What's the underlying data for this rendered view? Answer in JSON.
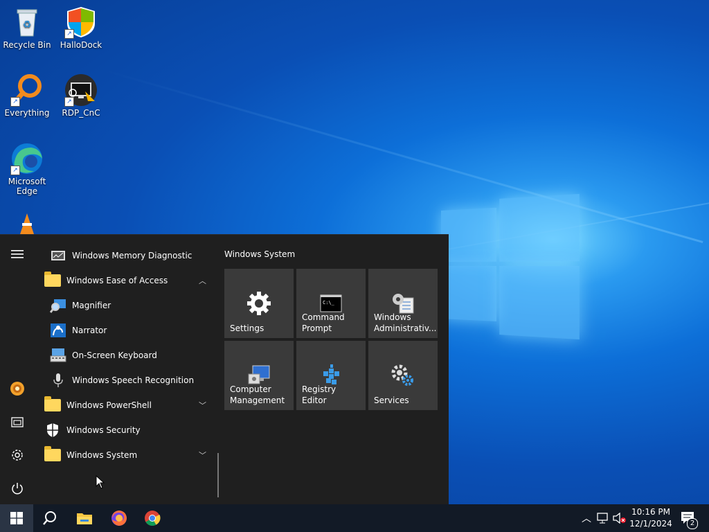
{
  "desktop_icons": [
    {
      "label": "Recycle Bin",
      "icon": "recycle-bin-icon"
    },
    {
      "label": "HalloDock",
      "icon": "hallodock-icon"
    },
    {
      "label": "Everything",
      "icon": "everything-search-icon"
    },
    {
      "label": "RDP_CnC",
      "icon": "rdp-icon"
    },
    {
      "label": "Microsoft Edge",
      "icon": "edge-icon"
    }
  ],
  "start_menu": {
    "apps": [
      {
        "label": "Windows Memory Diagnostic",
        "icon": "memory-diagnostic-icon"
      },
      {
        "label": "Windows Ease of Access",
        "icon": "folder-icon",
        "expanded": true
      },
      {
        "label": "Magnifier",
        "icon": "magnifier-icon"
      },
      {
        "label": "Narrator",
        "icon": "narrator-icon"
      },
      {
        "label": "On-Screen Keyboard",
        "icon": "keyboard-icon"
      },
      {
        "label": "Windows Speech Recognition",
        "icon": "microphone-icon"
      },
      {
        "label": "Windows PowerShell",
        "icon": "folder-icon",
        "expanded": false
      },
      {
        "label": "Windows Security",
        "icon": "shield-icon"
      },
      {
        "label": "Windows System",
        "icon": "folder-icon",
        "expanded": false
      }
    ],
    "tile_group_title": "Windows System",
    "tiles": [
      {
        "label": "Settings",
        "icon": "gear-icon"
      },
      {
        "label": "Command Prompt",
        "icon": "cmd-icon"
      },
      {
        "label": "Windows Administrativ...",
        "icon": "admin-tools-icon"
      },
      {
        "label": "Computer Management",
        "icon": "computer-management-icon"
      },
      {
        "label": "Registry Editor",
        "icon": "registry-icon"
      },
      {
        "label": "Services",
        "icon": "services-icon"
      }
    ]
  },
  "taskbar": {
    "clock_time": "10:16 PM",
    "clock_date": "12/1/2024",
    "notification_count": "2"
  }
}
